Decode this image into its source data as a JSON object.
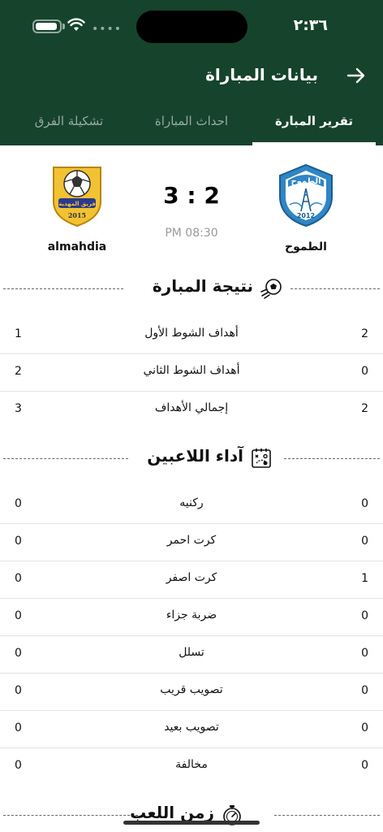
{
  "status_bar": {
    "time": "٢:٣٦"
  },
  "header": {
    "title": "بيانات المباراة",
    "back_icon": "arrow-right-icon"
  },
  "tabs": [
    {
      "label": "تقرير المبارة",
      "active": true
    },
    {
      "label": "احداث المباراة",
      "active": false
    },
    {
      "label": "تشكيلة الفرق",
      "active": false
    }
  ],
  "match": {
    "home_team": {
      "name": "الطموح",
      "logo_text": "الطموح",
      "logo_year": "2012"
    },
    "away_team": {
      "name": "almahdia",
      "logo_text": "فريق المهدية",
      "logo_year": "2015"
    },
    "score": "3 : 2",
    "time": "PM 08:30"
  },
  "sections": {
    "result": {
      "title": "نتيجة المبارة",
      "icon": "soccer-ball-icon",
      "rows": [
        {
          "label": "أهداف الشوط الأول",
          "home": "2",
          "away": "1"
        },
        {
          "label": "أهداف الشوط الثاني",
          "home": "0",
          "away": "2"
        },
        {
          "label": "إجمالي الأهداف",
          "home": "2",
          "away": "3"
        }
      ]
    },
    "players": {
      "title": "آداء اللاعبين",
      "icon": "tactics-board-icon",
      "rows": [
        {
          "label": "ركنيه",
          "home": "0",
          "away": "0"
        },
        {
          "label": "كرت احمر",
          "home": "0",
          "away": "0"
        },
        {
          "label": "كرت اصفر",
          "home": "1",
          "away": "0"
        },
        {
          "label": "ضربة جزاء",
          "home": "0",
          "away": "0"
        },
        {
          "label": "تسلل",
          "home": "0",
          "away": "0"
        },
        {
          "label": "تصويب قريب",
          "home": "0",
          "away": "0"
        },
        {
          "label": "تصويب بعيد",
          "home": "0",
          "away": "0"
        },
        {
          "label": "مخالفة",
          "home": "0",
          "away": "0"
        }
      ]
    },
    "playtime": {
      "title": "زمن اللعب",
      "icon": "stopwatch-icon"
    }
  },
  "colors": {
    "header_bg": "#16432c",
    "home_logo_blue": "#2f86c6",
    "away_logo_gold": "#f1c232"
  }
}
